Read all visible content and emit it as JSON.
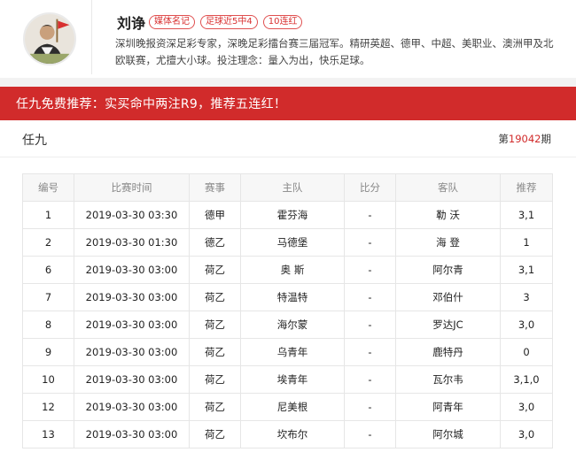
{
  "profile": {
    "name": "刘诤",
    "tags": [
      "媒体名记",
      "足球近5中4",
      "10连红"
    ],
    "bio": "深圳晚报资深足彩专家，深晚足彩擂台赛三届冠军。精研英超、德甲、中超、美职业、澳洲甲及北欧联赛，尤擅大小球。投注理念：量入为出，快乐足球。"
  },
  "banner": {
    "text": "任九免费推荐：实买命中两注R9，推荐五连红！"
  },
  "section": {
    "title": "任九",
    "issue_prefix": "第",
    "issue_number": "19042",
    "issue_suffix": "期"
  },
  "table": {
    "headers": [
      "编号",
      "比赛时间",
      "赛事",
      "主队",
      "比分",
      "客队",
      "推荐"
    ],
    "rows": [
      [
        "1",
        "2019-03-30 03:30",
        "德甲",
        "霍芬海",
        "-",
        "勒 沃",
        "3,1"
      ],
      [
        "2",
        "2019-03-30 01:30",
        "德乙",
        "马德堡",
        "-",
        "海 登",
        "1"
      ],
      [
        "6",
        "2019-03-30 03:00",
        "荷乙",
        "奥 斯",
        "-",
        "阿尔青",
        "3,1"
      ],
      [
        "7",
        "2019-03-30 03:00",
        "荷乙",
        "特温特",
        "-",
        "邓伯什",
        "3"
      ],
      [
        "8",
        "2019-03-30 03:00",
        "荷乙",
        "海尔蒙",
        "-",
        "罗达JC",
        "3,0"
      ],
      [
        "9",
        "2019-03-30 03:00",
        "荷乙",
        "乌青年",
        "-",
        "鹿特丹",
        "0"
      ],
      [
        "10",
        "2019-03-30 03:00",
        "荷乙",
        "埃青年",
        "-",
        "瓦尔韦",
        "3,1,0"
      ],
      [
        "12",
        "2019-03-30 03:00",
        "荷乙",
        "尼美根",
        "-",
        "阿青年",
        "3,0"
      ],
      [
        "13",
        "2019-03-30 03:00",
        "荷乙",
        "坎布尔",
        "-",
        "阿尔城",
        "3,0"
      ]
    ]
  },
  "colors": {
    "accent": "#d12b2b",
    "tag_border": "#e05050"
  },
  "icons": {
    "corner": "site-logo-icon",
    "avatar": "expert-avatar"
  }
}
